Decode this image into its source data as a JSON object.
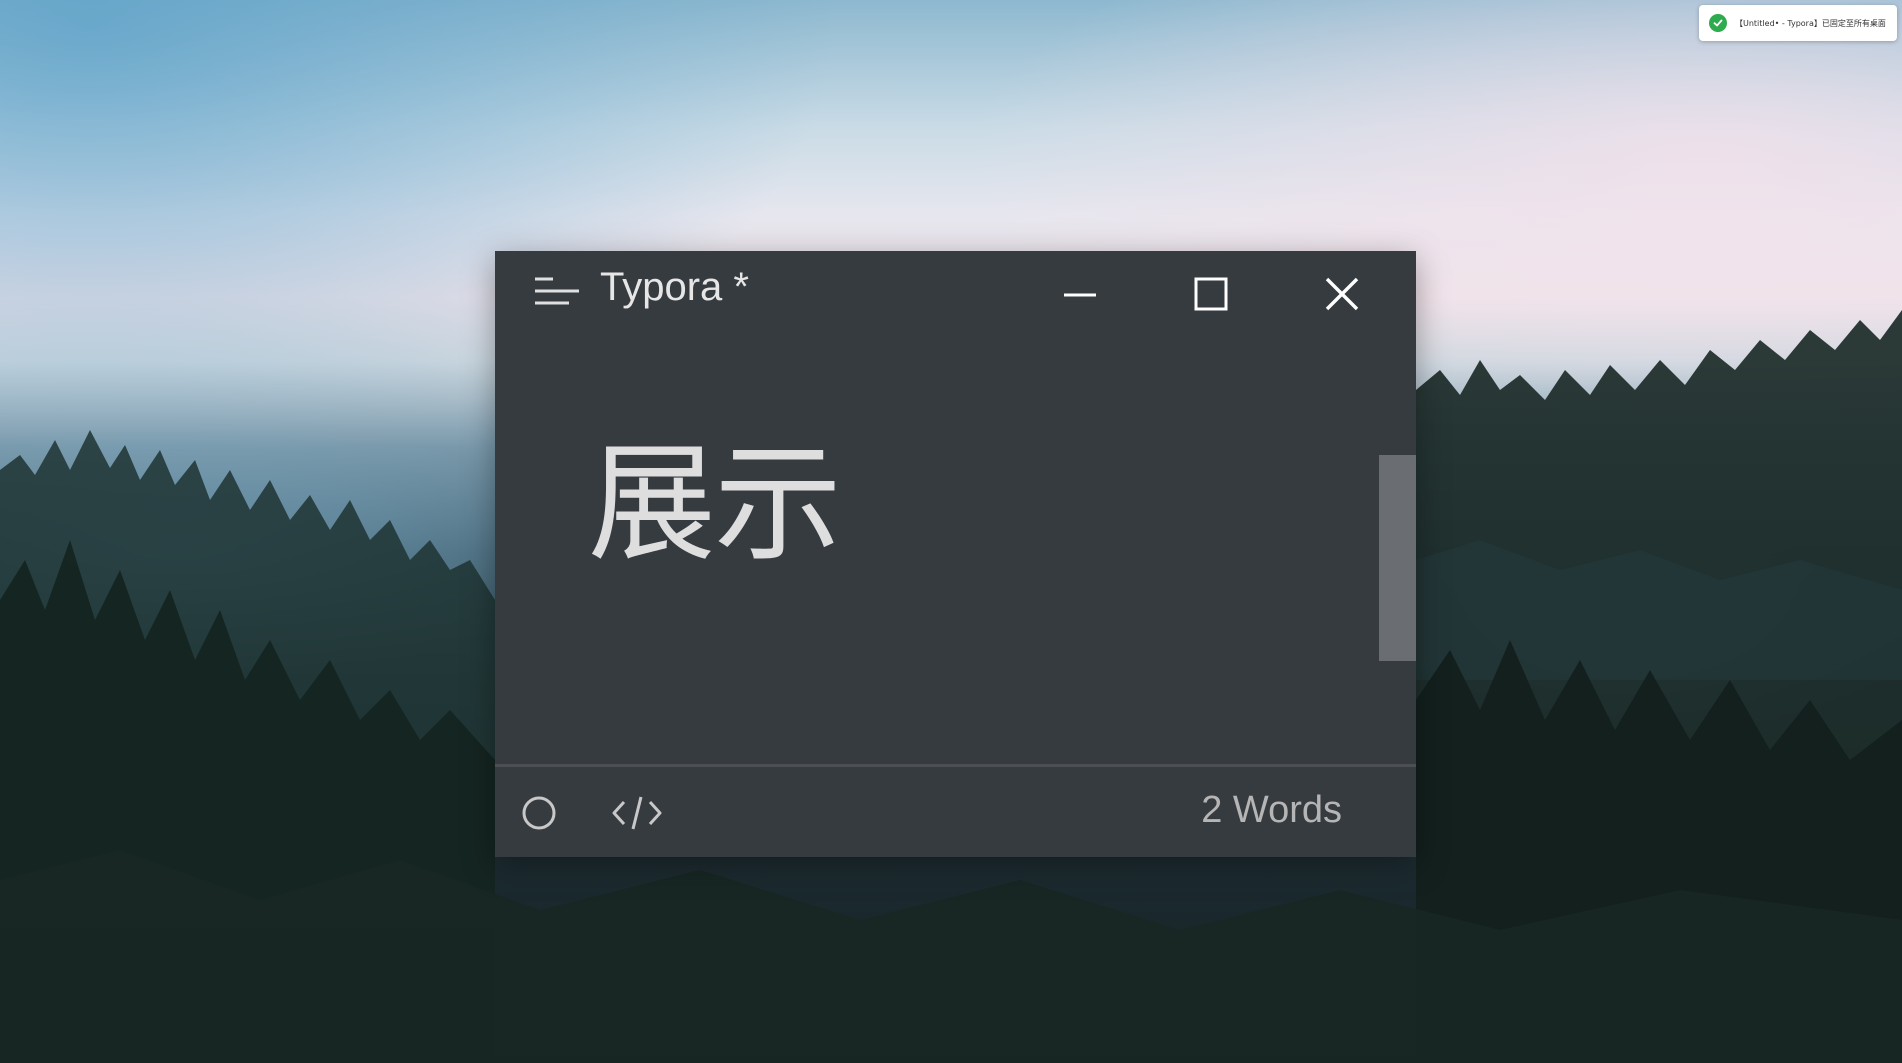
{
  "notification": {
    "icon": "check-circle-icon",
    "text": "【Untitled• - Typora】已固定至所有桌面"
  },
  "window": {
    "title": "Typora *",
    "menu_icon": "hamburger-menu-icon",
    "controls": {
      "minimize_icon": "minimize-icon",
      "maximize_icon": "maximize-icon",
      "close_icon": "close-icon"
    }
  },
  "editor": {
    "heading": "展示"
  },
  "status_bar": {
    "sidebar_icon": "circle-icon",
    "source_icon": "code-icon",
    "word_count": "2 Words"
  },
  "colors": {
    "window_bg": "#363b40",
    "text": "#dedede",
    "toast_check": "#2eaa4f"
  }
}
